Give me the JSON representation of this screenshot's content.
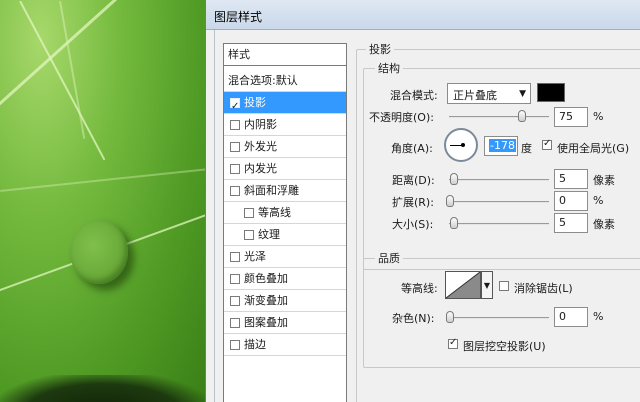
{
  "dialog": {
    "title": "图层样式"
  },
  "styles_list": {
    "header": "样式",
    "blend_options": "混合选项:默认",
    "items": [
      {
        "label": "投影",
        "checked": true,
        "selected": true
      },
      {
        "label": "内阴影",
        "checked": false
      },
      {
        "label": "外发光",
        "checked": false
      },
      {
        "label": "内发光",
        "checked": false
      },
      {
        "label": "斜面和浮雕",
        "checked": false
      },
      {
        "label": "等高线",
        "checked": false,
        "sub": true
      },
      {
        "label": "纹理",
        "checked": false,
        "sub": true
      },
      {
        "label": "光泽",
        "checked": false
      },
      {
        "label": "颜色叠加",
        "checked": false
      },
      {
        "label": "渐变叠加",
        "checked": false
      },
      {
        "label": "图案叠加",
        "checked": false
      },
      {
        "label": "描边",
        "checked": false
      }
    ]
  },
  "drop_shadow": {
    "section_title": "投影",
    "structure": {
      "title": "结构",
      "blend_mode_label": "混合模式:",
      "blend_mode_value": "正片叠底",
      "opacity_label": "不透明度(O):",
      "opacity_value": "75",
      "opacity_unit": "%",
      "opacity_level": 0.75,
      "angle_label": "角度(A):",
      "angle_value": "-178",
      "angle_unit": "度",
      "global_light_label": "使用全局光(G)",
      "global_light_checked": true,
      "distance_label": "距离(D):",
      "distance_value": "5",
      "distance_unit": "像素",
      "spread_label": "扩展(R):",
      "spread_value": "0",
      "spread_unit": "%",
      "size_label": "大小(S):",
      "size_value": "5",
      "size_unit": "像素",
      "shadow_color": "#000000"
    },
    "quality": {
      "title": "品质",
      "contour_label": "等高线:",
      "anti_alias_label": "消除锯齿(L)",
      "anti_alias_checked": false,
      "noise_label": "杂色(N):",
      "noise_value": "0",
      "noise_unit": "%",
      "knockout_label": "图层挖空投影(U)",
      "knockout_checked": true
    }
  },
  "colors": {
    "selection": "#3399ff",
    "titlebar": "#c9d8ea"
  }
}
